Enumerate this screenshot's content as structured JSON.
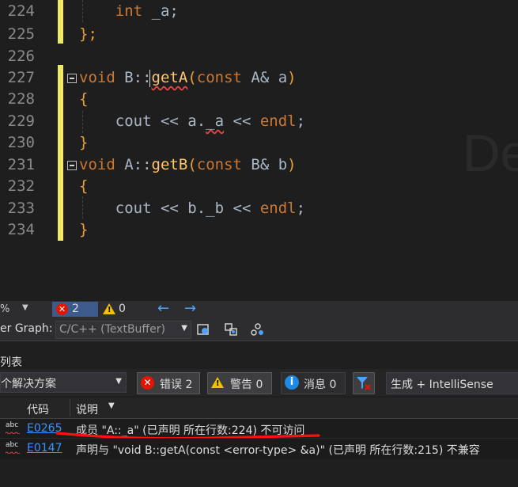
{
  "editor": {
    "watermark": "De",
    "lines": [
      {
        "num": "224",
        "parts": [
          {
            "t": "    "
          },
          {
            "t": "int",
            "c": "kw"
          },
          {
            "t": " _a;",
            "c": "id"
          }
        ]
      },
      {
        "num": "225",
        "parts": [
          {
            "t": "};",
            "c": "br"
          }
        ]
      },
      {
        "num": "226",
        "parts": []
      },
      {
        "num": "227",
        "parts": [
          {
            "t": "void",
            "c": "kw"
          },
          {
            "t": " B::",
            "c": "id"
          },
          {
            "t": "getA",
            "c": "fn",
            "sq": true
          },
          {
            "t": "(",
            "c": "br"
          },
          {
            "t": "const",
            "c": "kw"
          },
          {
            "t": " A& a",
            "c": "id"
          },
          {
            "t": ")",
            "c": "br"
          }
        ]
      },
      {
        "num": "228",
        "parts": [
          {
            "t": "{",
            "c": "br"
          }
        ]
      },
      {
        "num": "229",
        "parts": [
          {
            "t": "    "
          },
          {
            "t": "cout",
            "c": "id"
          },
          {
            "t": " << a.",
            "c": "op"
          },
          {
            "t": "_a",
            "c": "id",
            "sq": true
          },
          {
            "t": " << ",
            "c": "op"
          },
          {
            "t": "endl",
            "c": "kw"
          },
          {
            "t": ";",
            "c": "punc"
          }
        ]
      },
      {
        "num": "230",
        "parts": [
          {
            "t": "}",
            "c": "br"
          }
        ]
      },
      {
        "num": "231",
        "parts": [
          {
            "t": "void",
            "c": "kw"
          },
          {
            "t": " A::",
            "c": "id"
          },
          {
            "t": "getB",
            "c": "fn"
          },
          {
            "t": "(",
            "c": "br"
          },
          {
            "t": "const",
            "c": "kw"
          },
          {
            "t": " B& b",
            "c": "id"
          },
          {
            "t": ")",
            "c": "br"
          }
        ]
      },
      {
        "num": "232",
        "parts": [
          {
            "t": "{",
            "c": "br"
          }
        ]
      },
      {
        "num": "233",
        "parts": [
          {
            "t": "    "
          },
          {
            "t": "cout",
            "c": "id"
          },
          {
            "t": " << b.",
            "c": "op"
          },
          {
            "t": "_b",
            "c": "id"
          },
          {
            "t": " << ",
            "c": "op"
          },
          {
            "t": "endl",
            "c": "kw"
          },
          {
            "t": ";",
            "c": "punc"
          }
        ]
      },
      {
        "num": "234",
        "parts": [
          {
            "t": "}",
            "c": "br"
          }
        ]
      }
    ]
  },
  "status": {
    "zoom": "%",
    "errors": "2",
    "warnings": "0"
  },
  "graph": {
    "label": "er Graph:",
    "value": "C/C++ (TextBuffer)"
  },
  "error_list": {
    "title": "列表",
    "scope": "个解决方案",
    "errors_label": "错误 2",
    "warnings_label": "警告 0",
    "messages_label": "消息 0",
    "build_filter": "生成 + IntelliSense",
    "columns": {
      "code": "代码",
      "description": "说明"
    },
    "rows": [
      {
        "code": "E0265",
        "description": "成员 \"A::_a\" (已声明 所在行数:224) 不可访问"
      },
      {
        "code": "E0147",
        "description": "声明与 \"void B::getA(const <error-type> &a)\" (已声明 所在行数:215) 不兼容"
      }
    ]
  },
  "colors": {
    "accent": "#3794ff",
    "error": "#e51400",
    "warning": "#f2c200",
    "modified_margin": "#efe96a"
  }
}
